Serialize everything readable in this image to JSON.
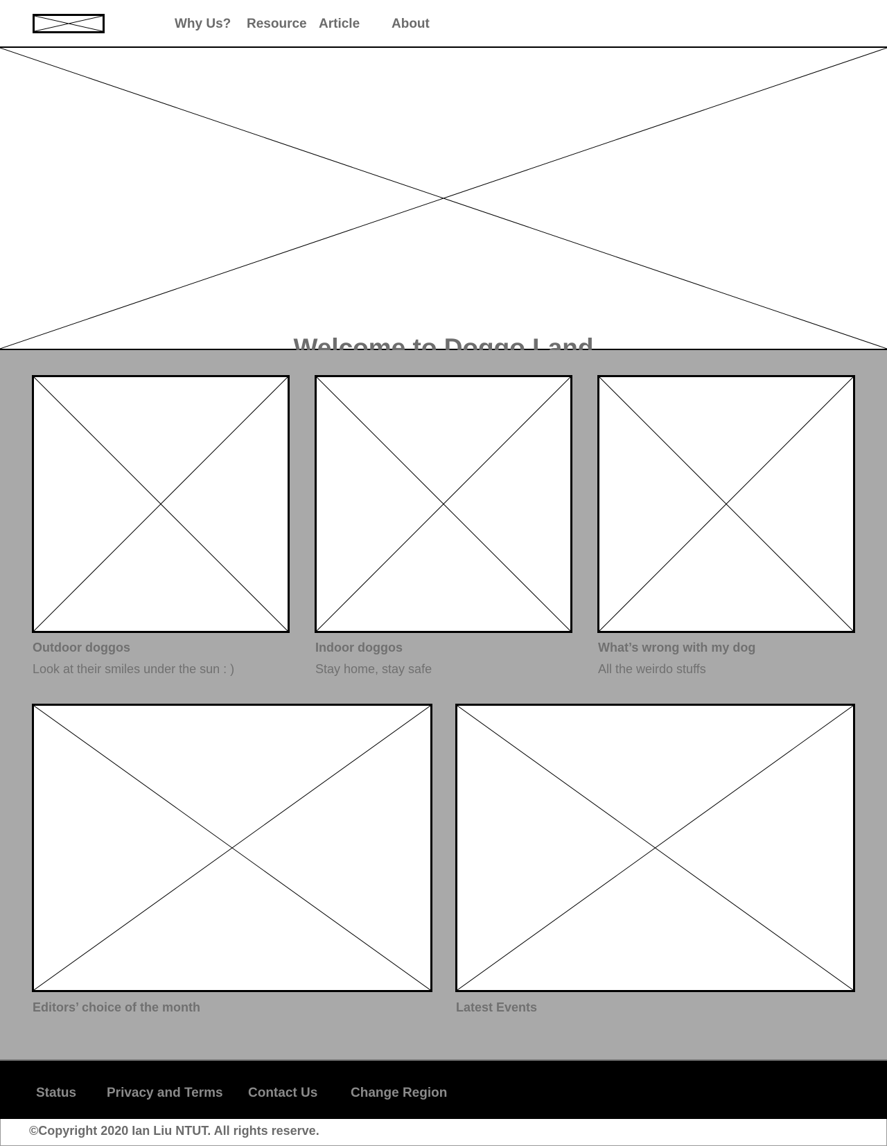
{
  "nav": {
    "logo_icon": "placeholder-x-icon",
    "items": [
      {
        "label": "Why Us?"
      },
      {
        "label": "Resource"
      },
      {
        "label": "Article"
      },
      {
        "label": "About"
      }
    ]
  },
  "hero": {
    "title": "Welcome to Doggo Land",
    "image_icon": "placeholder-x-icon"
  },
  "cards": [
    {
      "title": "Outdoor doggos",
      "subtitle": "Look at their smiles under the sun : )"
    },
    {
      "title": "Indoor doggos",
      "subtitle": "Stay home, stay safe"
    },
    {
      "title": "What’s wrong with my dog",
      "subtitle": "All the weirdo stuffs"
    }
  ],
  "features": [
    {
      "title": "Editors’ choice of the month"
    },
    {
      "title": "Latest Events"
    }
  ],
  "footer": {
    "links": [
      {
        "label": "Status"
      },
      {
        "label": "Privacy and Terms"
      },
      {
        "label": "Contact Us"
      },
      {
        "label": "Change Region"
      }
    ],
    "copyright": "©Copyright 2020 Ian Liu NTUT. All rights reserve."
  },
  "colors": {
    "content_background": "#a9a9a9",
    "footer_background": "#000000",
    "text_gray": "#6b6b6b"
  }
}
